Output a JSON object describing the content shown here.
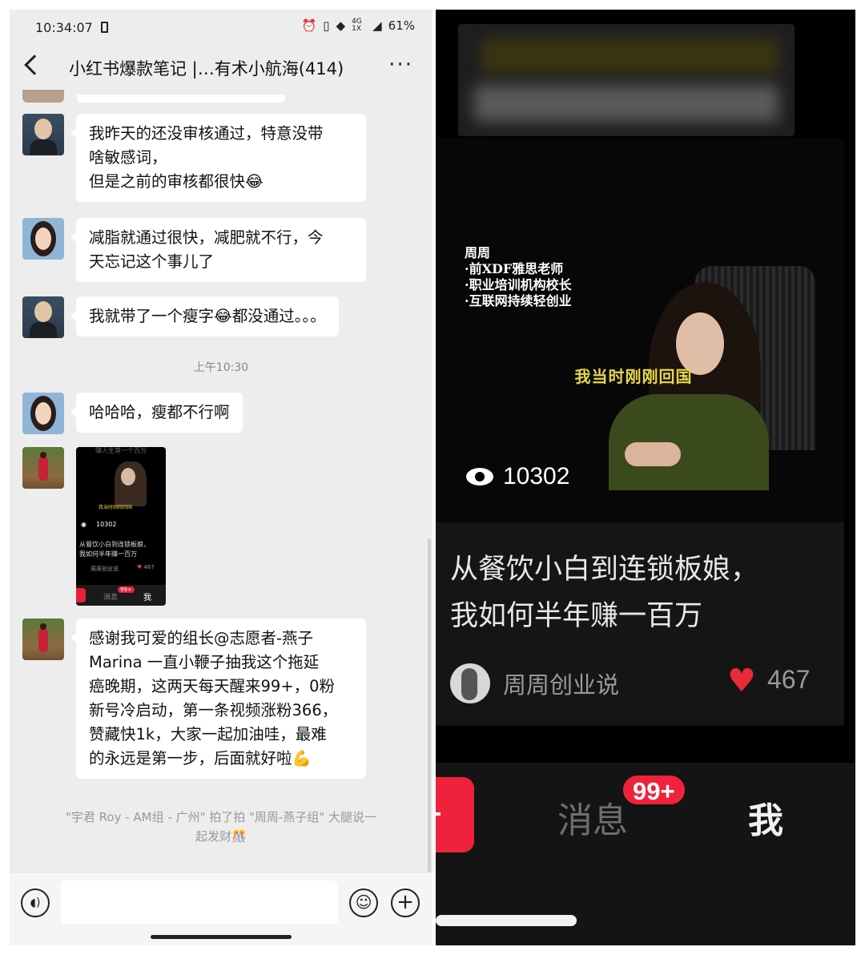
{
  "status": {
    "time": "10:34:07",
    "network": "4G 1X",
    "battery": "61%"
  },
  "chat": {
    "title": "小红书爆款笔记 |…有术小航海(414)",
    "messages": [
      {
        "text_lines": [
          "我昨天的还没审核通过，特意没带",
          "啥敏感词，",
          "但是之前的审核都很快😂"
        ]
      },
      {
        "text_lines": [
          "减脂就通过很快，减肥就不行，今",
          "天忘记这个事儿了"
        ]
      },
      {
        "text_lines": [
          "我就带了一个瘦字😂都没通过。。。"
        ]
      },
      {
        "text_lines": [
          "哈哈哈，瘦都不行啊"
        ]
      },
      {
        "text_lines": [
          "感谢我可爱的组长@志愿者-燕子",
          "Marina 一直小鞭子抽我这个拖延",
          "癌晚期，这两天每天醒来99+，0粉",
          "新号冷启动，第一条视频涨粉366，",
          "赞藏快1k，大家一起加油哇，最难",
          "的永远是第一步，后面就好啦💪"
        ]
      }
    ],
    "timestamp": "上午10:30",
    "thumbnail": {
      "top_text": "赚人生第一个百万",
      "subtitle": "我当时刚刚回国",
      "views": "10302",
      "title_lines": [
        "从餐饮小白到连锁板娘，",
        "我如何半年赚一百万"
      ],
      "author": "周周创业说",
      "likes": "467",
      "nav_msg": "消息",
      "nav_badge": "99+",
      "nav_me": "我"
    },
    "system_note_lines": [
      "\"宇君 Roy - AM组 - 广州\" 拍了拍 \"周周-燕子组\" 大腿说一",
      "起发财🎊"
    ]
  },
  "video": {
    "intro_lines": [
      "周周",
      "·前XDF雅思老师",
      "·职业培训机构校长",
      "·互联网持续轻创业"
    ],
    "subtitle": "我当时刚刚回国",
    "views": "10302",
    "title_lines": [
      "从餐饮小白到连锁板娘，",
      "我如何半年赚一百万"
    ],
    "author": "周周创业说",
    "likes": "467"
  },
  "bottom_nav": {
    "messages_label": "消息",
    "badge": "99+",
    "me_label": "我"
  },
  "colors": {
    "accent_red": "#f0223b",
    "chat_bg": "#ededed",
    "subtitle_yellow": "#e7d74a"
  }
}
